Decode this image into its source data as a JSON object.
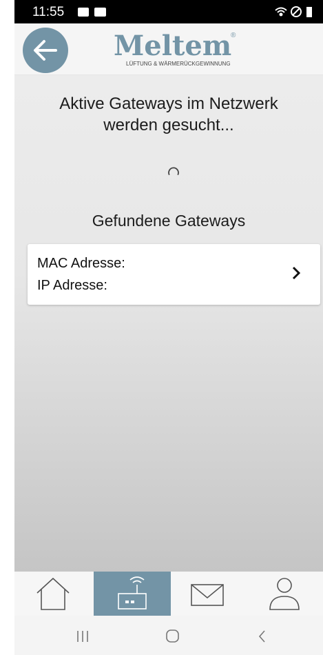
{
  "statusbar": {
    "time": "11:55",
    "icons": [
      "photo-icon",
      "mail-icon",
      "wifi-icon",
      "do-not-disturb-icon",
      "battery-icon"
    ]
  },
  "header": {
    "back_icon": "arrow-left-icon",
    "logo_name": "Meltem",
    "logo_tagline": "LÜFTUNG & WÄRMERÜCKGEWINNUNG",
    "accent_color": "#7394a6"
  },
  "main": {
    "search_line1": "Aktive Gateways im Netzwerk",
    "search_line2": "werden gesucht...",
    "found_title": "Gefundene Gateways",
    "gateways": [
      {
        "mac_label": "MAC Adresse:",
        "ip_label": "IP Adresse:",
        "chevron_icon": "chevron-right-icon"
      }
    ]
  },
  "tabbar": {
    "tabs": [
      {
        "icon": "home-icon",
        "active": false
      },
      {
        "icon": "gateway-router-icon",
        "active": true
      },
      {
        "icon": "mail-icon",
        "active": false
      },
      {
        "icon": "user-icon",
        "active": false
      }
    ]
  },
  "navbar": {
    "buttons": [
      "recent-apps-icon",
      "home-circle-icon",
      "back-chevron-icon"
    ]
  }
}
